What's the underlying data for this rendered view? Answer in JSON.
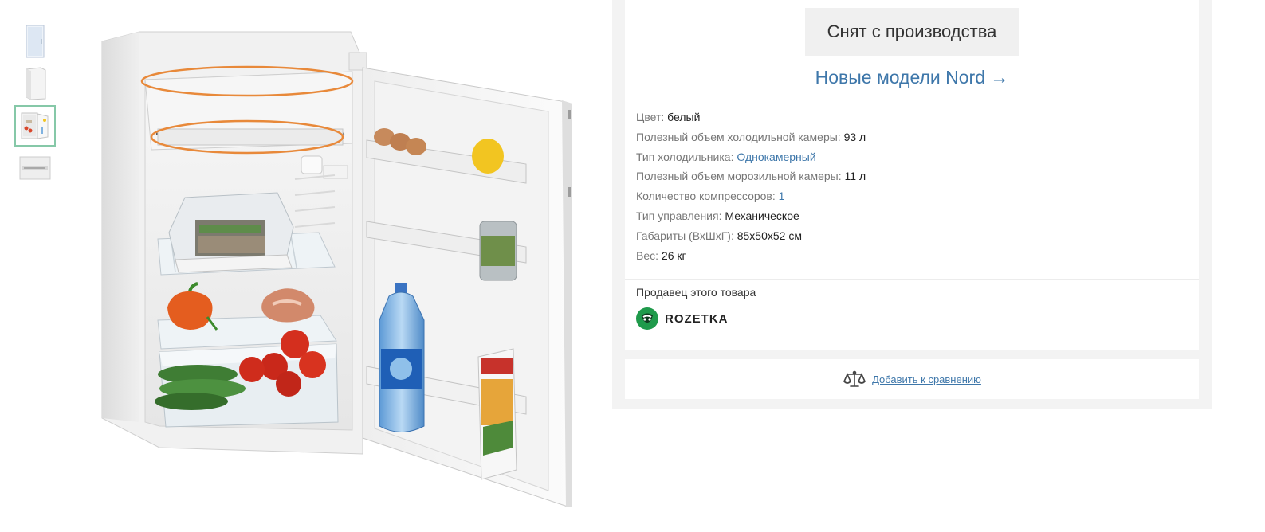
{
  "product": {
    "status": "Снят с производства",
    "new_models_link": "Новые модели Nord →",
    "specs": [
      {
        "label": "Цвет:",
        "value": "белый"
      },
      {
        "label": "Полезный объем холодильной камеры:",
        "value": "93 л"
      },
      {
        "label": "Тип холодильника:",
        "value": "Однокамерный"
      },
      {
        "label": "Полезный объем морозильной камеры:",
        "value": "11 л"
      },
      {
        "label": "Количество компрессоров:",
        "value": "1"
      },
      {
        "label": "Тип управления:",
        "value": "Механическое"
      },
      {
        "label": "Габариты (ВхШхГ):",
        "value": "85x50x52 см"
      },
      {
        "label": "Вес:",
        "value": "26 кг"
      }
    ]
  },
  "seller": {
    "title": "Продавец этого товара",
    "name": "ROZETKA"
  },
  "compare": {
    "label": "Добавить к сравнению"
  },
  "gallery": {
    "thumbnail_count": 4,
    "selected_thumbnail": 3
  },
  "colors": {
    "link": "#3e77aa",
    "highlight_ring": "#e8893a",
    "seller_green": "#1f9a4b",
    "panel_bg": "#f3f3f3"
  },
  "icons": [
    "scales-icon",
    "rozetka-logo-icon"
  ]
}
